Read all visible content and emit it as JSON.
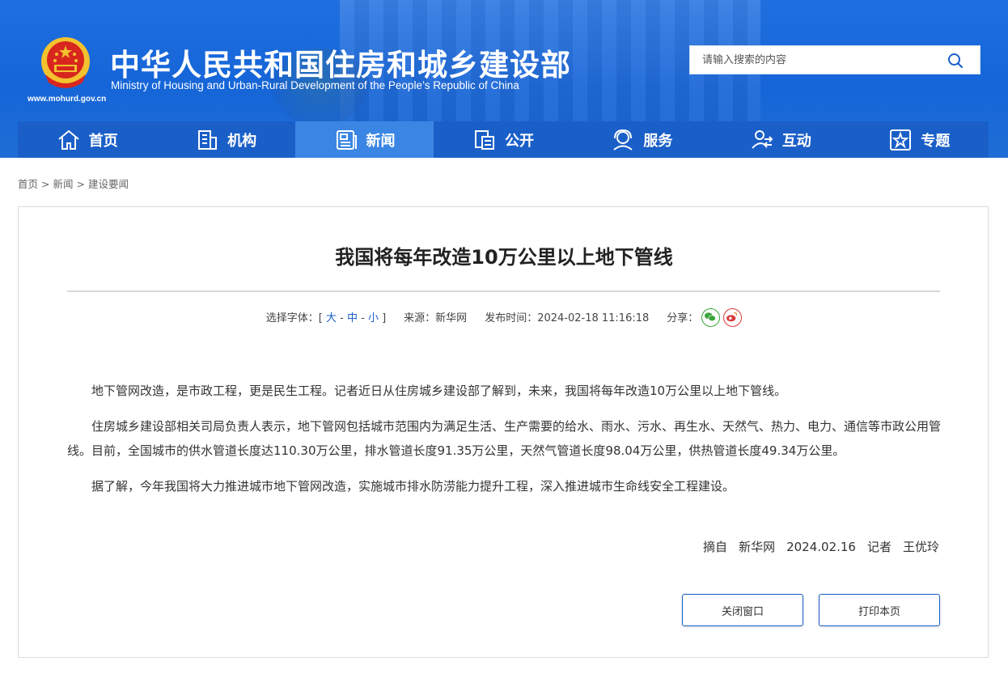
{
  "header": {
    "title_cn": "中华人民共和国住房和城乡建设部",
    "title_en": "Ministry of Housing and Urban-Rural Development of the People’s Republic of China",
    "site_url": "www.mohurd.gov.cn",
    "search": {
      "placeholder": "请输入搜索的内容"
    }
  },
  "nav": {
    "items": [
      {
        "label": "首页",
        "icon": "home-icon"
      },
      {
        "label": "机构",
        "icon": "building-icon"
      },
      {
        "label": "新闻",
        "icon": "news-icon",
        "active": true
      },
      {
        "label": "公开",
        "icon": "document-icon"
      },
      {
        "label": "服务",
        "icon": "service-icon"
      },
      {
        "label": "互动",
        "icon": "interact-icon"
      },
      {
        "label": "专题",
        "icon": "star-icon"
      }
    ]
  },
  "breadcrumb": {
    "items": [
      "首页",
      "新闻",
      "建设要闻"
    ],
    "separator": ">"
  },
  "article": {
    "title": "我国将每年改造10万公里以上地下管线",
    "meta": {
      "font_label": "选择字体：[",
      "font_large": "大",
      "font_medium": "中",
      "font_small": "小",
      "font_close": "]",
      "dash": "-",
      "source": "来源：新华网",
      "published": "发布时间：2024-02-18 11:16:18",
      "share_label": "分享："
    },
    "paragraphs": [
      "地下管网改造，是市政工程，更是民生工程。记者近日从住房城乡建设部了解到，未来，我国将每年改造10万公里以上地下管线。",
      "住房城乡建设部相关司局负责人表示，地下管网包括城市范围内为满足生活、生产需要的给水、雨水、污水、再生水、天然气、热力、电力、通信等市政公用管线。目前，全国城市的供水管道长度达110.30万公里，排水管道长度91.35万公里，天然气管道长度98.04万公里，供热管道长度49.34万公里。",
      "据了解，今年我国将大力推进城市地下管网改造，实施城市排水防涝能力提升工程，深入推进城市生命线安全工程建设。"
    ],
    "source_line": {
      "excerpt": "摘自",
      "outlet": "新华网",
      "date": "2024.02.16",
      "reporter_label": "记者",
      "reporter": "王优玲"
    }
  },
  "buttons": {
    "close": "关闭窗口",
    "print": "打印本页"
  },
  "colors": {
    "header_blue": "#1565d8",
    "nav_blue": "#1a5fc8",
    "nav_active": "#3b86e4",
    "wechat_green": "#3aa53a",
    "weibo_red": "#d83a3a"
  }
}
